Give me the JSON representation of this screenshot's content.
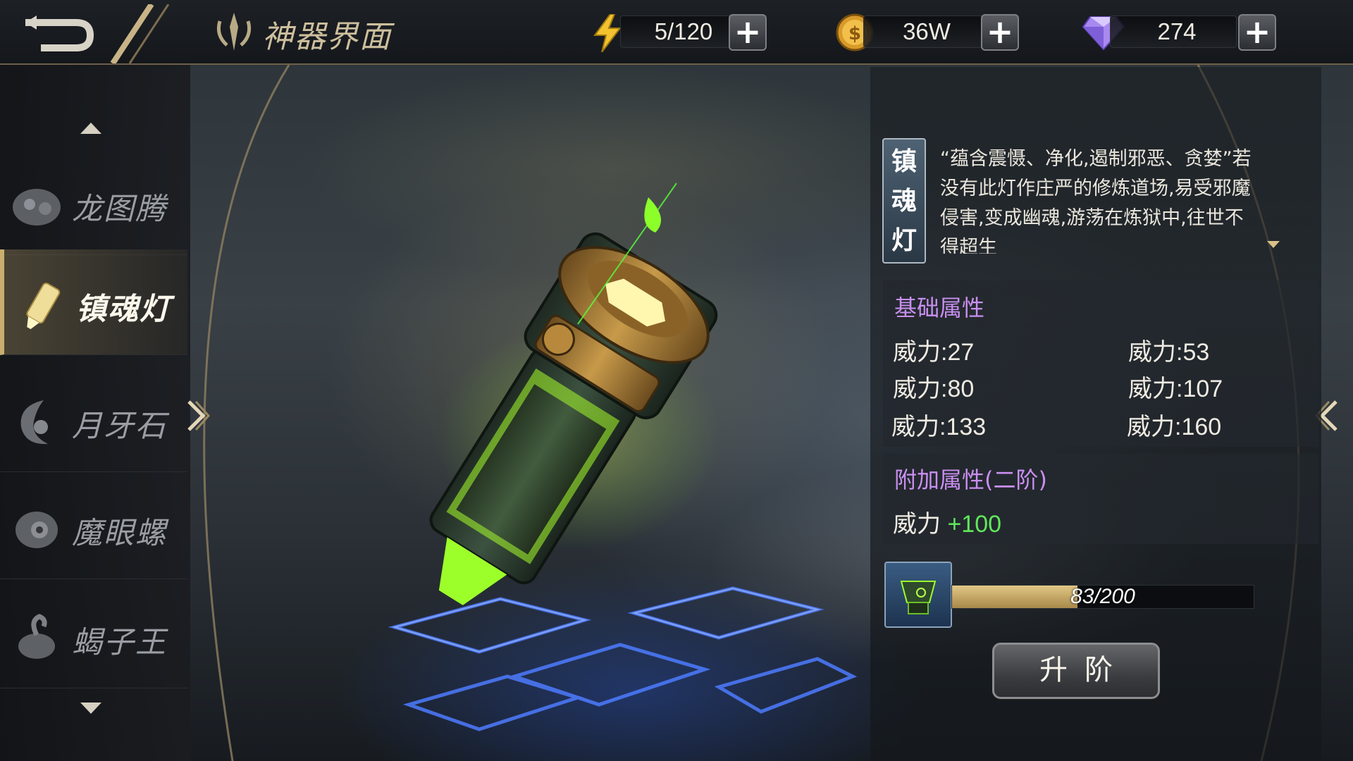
{
  "header": {
    "title": "神器界面",
    "resources": {
      "energy": "5/120",
      "gold": "36W",
      "diamond": "274"
    }
  },
  "sidebar": {
    "items": [
      {
        "label": "龙图腾",
        "icon": "dragon-totem-icon"
      },
      {
        "label": "镇魂灯",
        "icon": "soul-lamp-icon",
        "active": true
      },
      {
        "label": "月牙石",
        "icon": "crescent-stone-icon"
      },
      {
        "label": "魔眼螺",
        "icon": "demon-eye-shell-icon"
      },
      {
        "label": "蝎子王",
        "icon": "scorpion-king-icon"
      }
    ]
  },
  "artifact": {
    "name_chars": [
      "镇",
      "魂",
      "灯"
    ],
    "description": "“蕴含震慑、净化,遏制邪恶、贪婪”若没有此灯作庄严的修炼道场,易受邪魔侵害,变成幽魂,游荡在炼狱中,往世不得超生"
  },
  "base_attributes": {
    "title": "基础属性",
    "stats": [
      "威力:27",
      "威力:53",
      "威力:80",
      "威力:107",
      "威力:133",
      "威力:160"
    ]
  },
  "bonus_attributes": {
    "title": "附加属性(二阶)",
    "label": "威力",
    "value": "+100"
  },
  "upgrade": {
    "progress_text": "83/200",
    "progress_fraction": 0.415,
    "button_label": "升阶"
  },
  "colors": {
    "accent_gold": "#c9ae6e",
    "attr_title": "#c98ff0",
    "bonus_green": "#5fe85a",
    "artifact_glow": "#9cff2a"
  }
}
